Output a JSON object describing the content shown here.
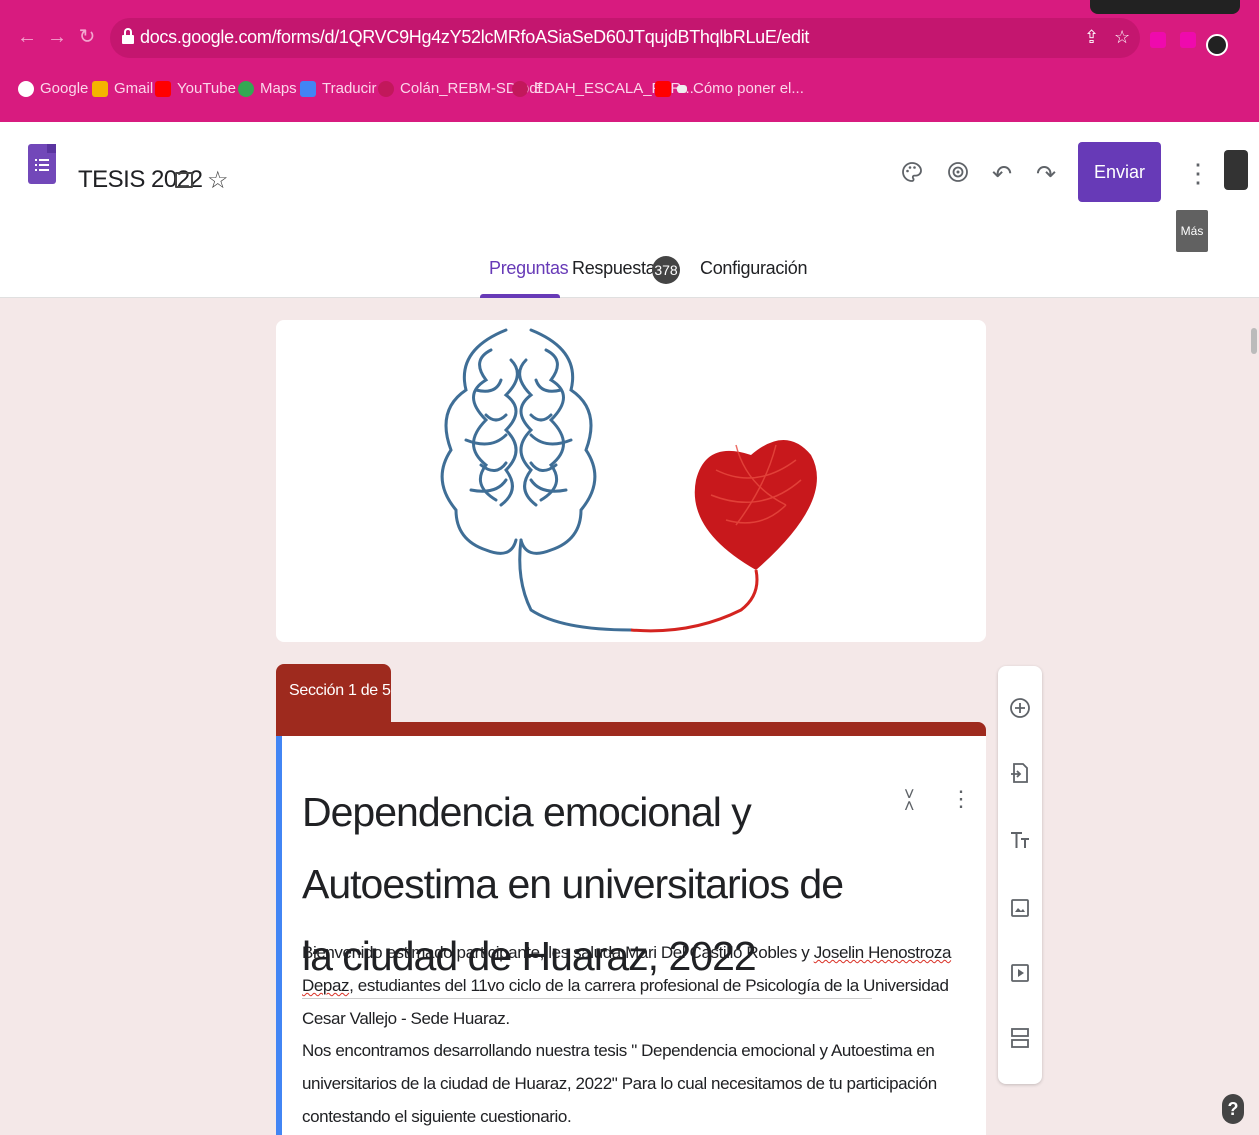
{
  "browser": {
    "url": "docs.google.com/forms/d/1QRVC9Hg4zY52lcMRfoASiaSeD60JTqujdBThqlbRLuE/edit",
    "bookmarks": [
      {
        "label": "Google",
        "color": "#ffffff"
      },
      {
        "label": "Gmail",
        "color": "#f4b400"
      },
      {
        "label": "YouTube",
        "color": "#ff0000"
      },
      {
        "label": "Maps",
        "color": "#34a853"
      },
      {
        "label": "Traducir",
        "color": "#4285f4"
      },
      {
        "label": "Colán_REBM-SD.pdf",
        "color": "#c2185b"
      },
      {
        "label": "EDAH_ESCALA_PAR...",
        "color": "#c2185b"
      },
      {
        "label": "Cómo poner el...",
        "color": "#ff0000"
      }
    ]
  },
  "header": {
    "title": "TESIS 2022",
    "send_label": "Enviar",
    "more_tooltip": "Más"
  },
  "tabs": {
    "questions": "Preguntas",
    "responses": "Respuestas",
    "responses_count": "378",
    "settings": "Configuración"
  },
  "section": {
    "label": "Sección 1 de 5"
  },
  "form": {
    "title": "Dependencia emocional y Autoestima en universitarios de la ciudad de Huaraz, 2022",
    "desc1_a": "Bienvenido estimado participante, les saluda Mari Del Castillo Robles y ",
    "desc1_b": "Joselin Henostroza Depaz",
    "desc1_c": ", estudiantes del 11vo ciclo de la carrera profesional de Psicología de la Universidad Cesar Vallejo - Sede Huaraz.",
    "desc2": "Nos encontramos desarrollando nuestra tesis \" Dependencia emocional y Autoestima en universitarios de la ciudad de Huaraz, 2022\"  Para lo cual necesitamos de tu participación contestando el siguiente cuestionario."
  },
  "colors": {
    "accent": "#673ab7",
    "section": "#9e2a1e",
    "browser": "#d81b7f",
    "background": "#f4e8e8"
  }
}
